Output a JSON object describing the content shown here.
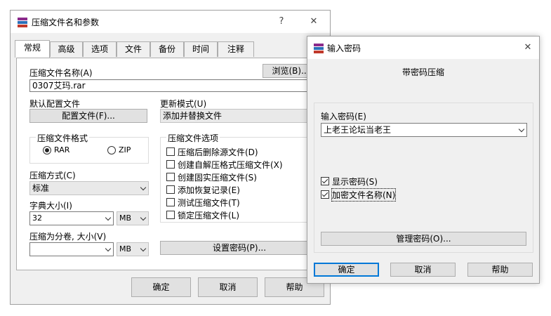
{
  "main": {
    "title": "压缩文件名和参数",
    "help_btn": "?",
    "close_btn": "✕",
    "tabs": [
      "常规",
      "高级",
      "选项",
      "文件",
      "备份",
      "时间",
      "注释"
    ],
    "archive_name_label": "压缩文件名称(A)",
    "archive_name_value": "0307艾玛.rar",
    "browse_btn": "浏览(B)...",
    "default_config_label": "默认配置文件",
    "config_btn": "配置文件(F)...",
    "update_mode_label": "更新模式(U)",
    "update_mode_value": "添加并替换文件",
    "format_group_title": "压缩文件格式",
    "format_rar": "RAR",
    "format_zip": "ZIP",
    "compression_method_label": "压缩方式(C)",
    "compression_method_value": "标准",
    "dict_size_label": "字典大小(I)",
    "dict_size_value": "32",
    "dict_unit": "MB",
    "split_label": "压缩为分卷, 大小(V)",
    "split_value": "",
    "split_unit": "MB",
    "options_group_title": "压缩文件选项",
    "options": [
      "压缩后删除源文件(D)",
      "创建自解压格式压缩文件(X)",
      "创建固实压缩文件(S)",
      "添加恢复记录(E)",
      "测试压缩文件(T)",
      "锁定压缩文件(L)"
    ],
    "set_password_btn": "设置密码(P)...",
    "ok_btn": "确定",
    "cancel_btn": "取消",
    "help_bottom_btn": "帮助"
  },
  "pwd": {
    "title": "输入密码",
    "close_btn": "✕",
    "heading": "带密码压缩",
    "enter_label": "输入密码(E)",
    "password_value": "上老王论坛当老王",
    "show_password": "显示密码(S)",
    "encrypt_names": "加密文件名称(N)",
    "manage_btn": "管理密码(O)...",
    "ok_btn": "确定",
    "cancel_btn": "取消",
    "help_btn": "帮助"
  },
  "colors": {
    "accent": "#0078d7",
    "dialog_bg": "#f0f0f0",
    "button_bg": "#e1e1e1"
  },
  "icons": {
    "app": "winrar-books-icon",
    "dropdown": "chevron-down-icon"
  }
}
